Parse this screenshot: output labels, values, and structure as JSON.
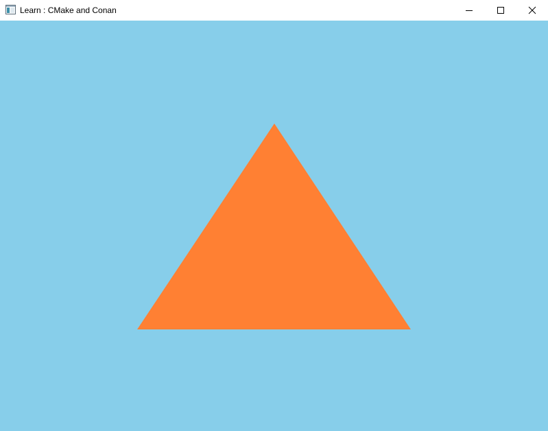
{
  "window": {
    "title": "Learn : CMake and Conan",
    "controls": {
      "minimize_icon": "minimize-icon",
      "maximize_icon": "maximize-icon",
      "close_icon": "close-icon"
    }
  },
  "scene": {
    "clear_color": "#87ceea",
    "triangle_color": "#ff8033",
    "shape": "triangle"
  },
  "colors": {
    "titlebar_bg": "#ffffff",
    "title_text": "#000000"
  }
}
